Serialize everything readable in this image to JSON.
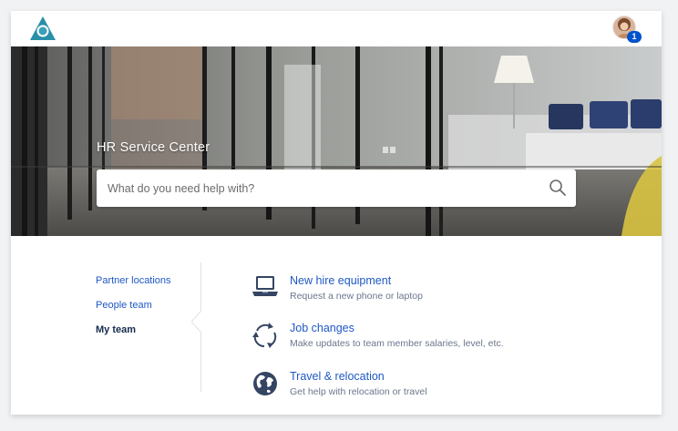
{
  "header": {
    "logo_icon": "triangle-logo-icon",
    "notification_count": "1",
    "accent_color": "#0052cc"
  },
  "hero": {
    "title": "HR Service Center",
    "search": {
      "placeholder": "What do you need help with?",
      "icon": "search-icon"
    }
  },
  "sidebar": {
    "items": [
      {
        "label": "Partner locations",
        "active": false
      },
      {
        "label": "People team",
        "active": false
      },
      {
        "label": "My team",
        "active": true
      }
    ]
  },
  "requests": [
    {
      "icon": "laptop-icon",
      "title": "New hire equipment",
      "description": "Request a new phone or laptop"
    },
    {
      "icon": "refresh-cycle-icon",
      "title": "Job changes",
      "description": "Make updates to team member salaries, level, etc."
    },
    {
      "icon": "globe-icon",
      "title": "Travel & relocation",
      "description": "Get help with relocation or travel"
    }
  ]
}
